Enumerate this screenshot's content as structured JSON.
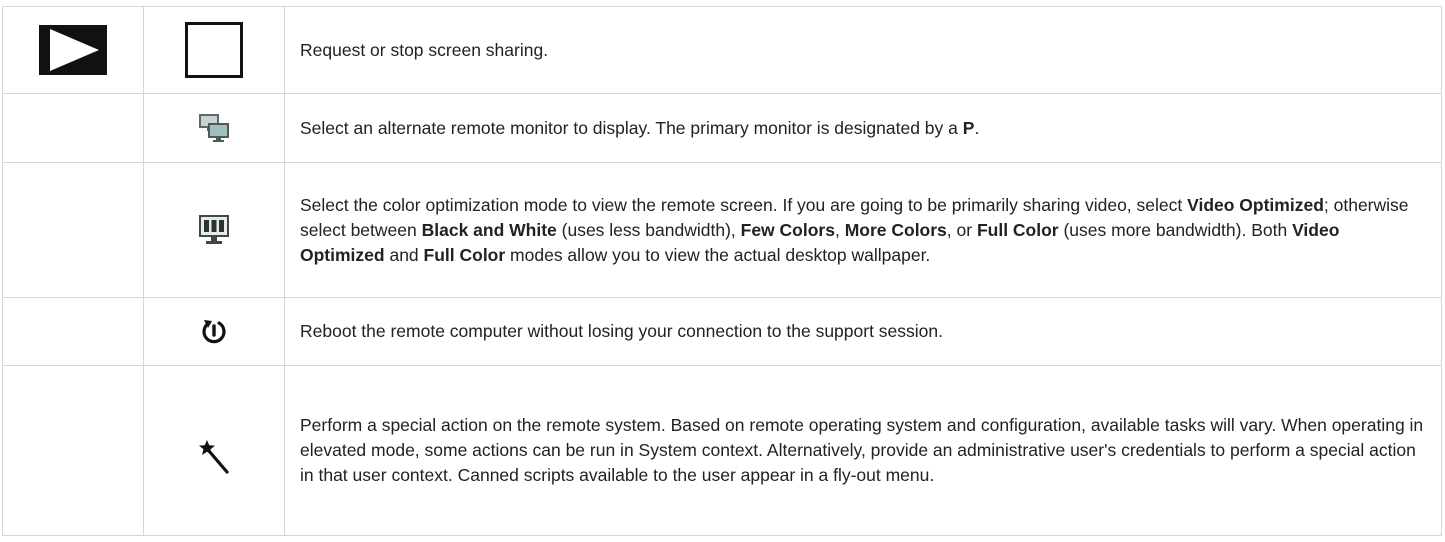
{
  "rows": [
    {
      "icons": [
        "play-icon",
        "stop-icon"
      ],
      "description": [
        {
          "t": "Request or stop screen sharing.",
          "b": false
        }
      ]
    },
    {
      "icons": [
        "monitors-icon"
      ],
      "description": [
        {
          "t": "Select an alternate remote monitor to display. The primary monitor is designated by a ",
          "b": false
        },
        {
          "t": "P",
          "b": true
        },
        {
          "t": ".",
          "b": false
        }
      ]
    },
    {
      "icons": [
        "color-mode-icon"
      ],
      "description": [
        {
          "t": "Select the color optimization mode to view the remote screen. If you are going to be primarily sharing video, select ",
          "b": false
        },
        {
          "t": "Video Optimized",
          "b": true
        },
        {
          "t": "; otherwise select between ",
          "b": false
        },
        {
          "t": "Black and White",
          "b": true
        },
        {
          "t": " (uses less bandwidth), ",
          "b": false
        },
        {
          "t": "Few Colors",
          "b": true
        },
        {
          "t": ", ",
          "b": false
        },
        {
          "t": "More Colors",
          "b": true
        },
        {
          "t": ", or ",
          "b": false
        },
        {
          "t": "Full Color",
          "b": true
        },
        {
          "t": " (uses more bandwidth). Both ",
          "b": false
        },
        {
          "t": "Video Optimized",
          "b": true
        },
        {
          "t": " and ",
          "b": false
        },
        {
          "t": "Full Color",
          "b": true
        },
        {
          "t": " modes allow you to view the actual desktop wallpaper.",
          "b": false
        }
      ]
    },
    {
      "icons": [
        "reboot-icon"
      ],
      "description": [
        {
          "t": "Reboot the remote computer without losing your connection to the support session.",
          "b": false
        }
      ]
    },
    {
      "icons": [
        "magic-wand-icon"
      ],
      "description": [
        {
          "t": "Perform a special action on the remote system. Based on remote operating system and configuration, available tasks will vary. When operating in elevated mode, some actions can be run in System context. Alternatively, provide an administrative user's credentials to perform a special action in that user context. Canned scripts available to the user appear in a fly-out menu.",
          "b": false
        }
      ]
    }
  ]
}
